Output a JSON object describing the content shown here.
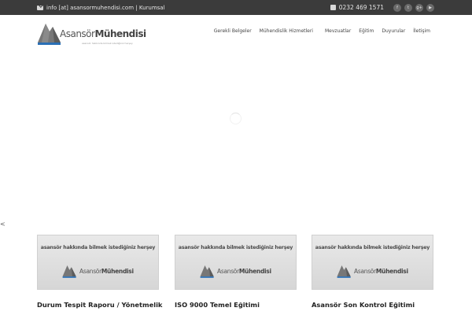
{
  "topbar": {
    "email_text": "info [at] asansormuhendisi.com | Kurumsal",
    "phone": "0232 469 1571",
    "social": [
      {
        "icon": "facebook-icon",
        "glyph": "f"
      },
      {
        "icon": "twitter-icon",
        "glyph": "t"
      },
      {
        "icon": "googleplus-icon",
        "glyph": "g+"
      },
      {
        "icon": "youtube-icon",
        "glyph": "▶"
      }
    ]
  },
  "logo": {
    "brand_light": "Asansör",
    "brand_bold": "Mühendisi",
    "tagline": "asansör hakkında bilmek istediğiniz herşey"
  },
  "nav": {
    "items": [
      "Gerekli Belgeler",
      "Mühendislik Hizmetleri",
      "Mevzuatlar",
      "Eğitim",
      "Duyurular",
      "İletişim"
    ]
  },
  "slider": {
    "prev_arrow": "<"
  },
  "cards": [
    {
      "thumb_text": "asansör hakkında bilmek istediğiniz herşey",
      "thumb_brand_light": "Asansör",
      "thumb_brand_bold": "Mühendisi",
      "title": "Durum Tespit Raporu / Yönetmelik"
    },
    {
      "thumb_text": "asansör hakkında bilmek istediğiniz herşey",
      "thumb_brand_light": "Asansör",
      "thumb_brand_bold": "Mühendisi",
      "title": "ISO 9000 Temel Eğitimi"
    },
    {
      "thumb_text": "asansör hakkında bilmek istediğiniz herşey",
      "thumb_brand_light": "Asansör",
      "thumb_brand_bold": "Mühendisi",
      "title": "Asansör Son Kontrol Eğitimi"
    }
  ],
  "colors": {
    "topbar_bg": "#3b3b3b",
    "accent_blue": "#2a6fb5",
    "mountain_gray": "#6d6d6d"
  }
}
